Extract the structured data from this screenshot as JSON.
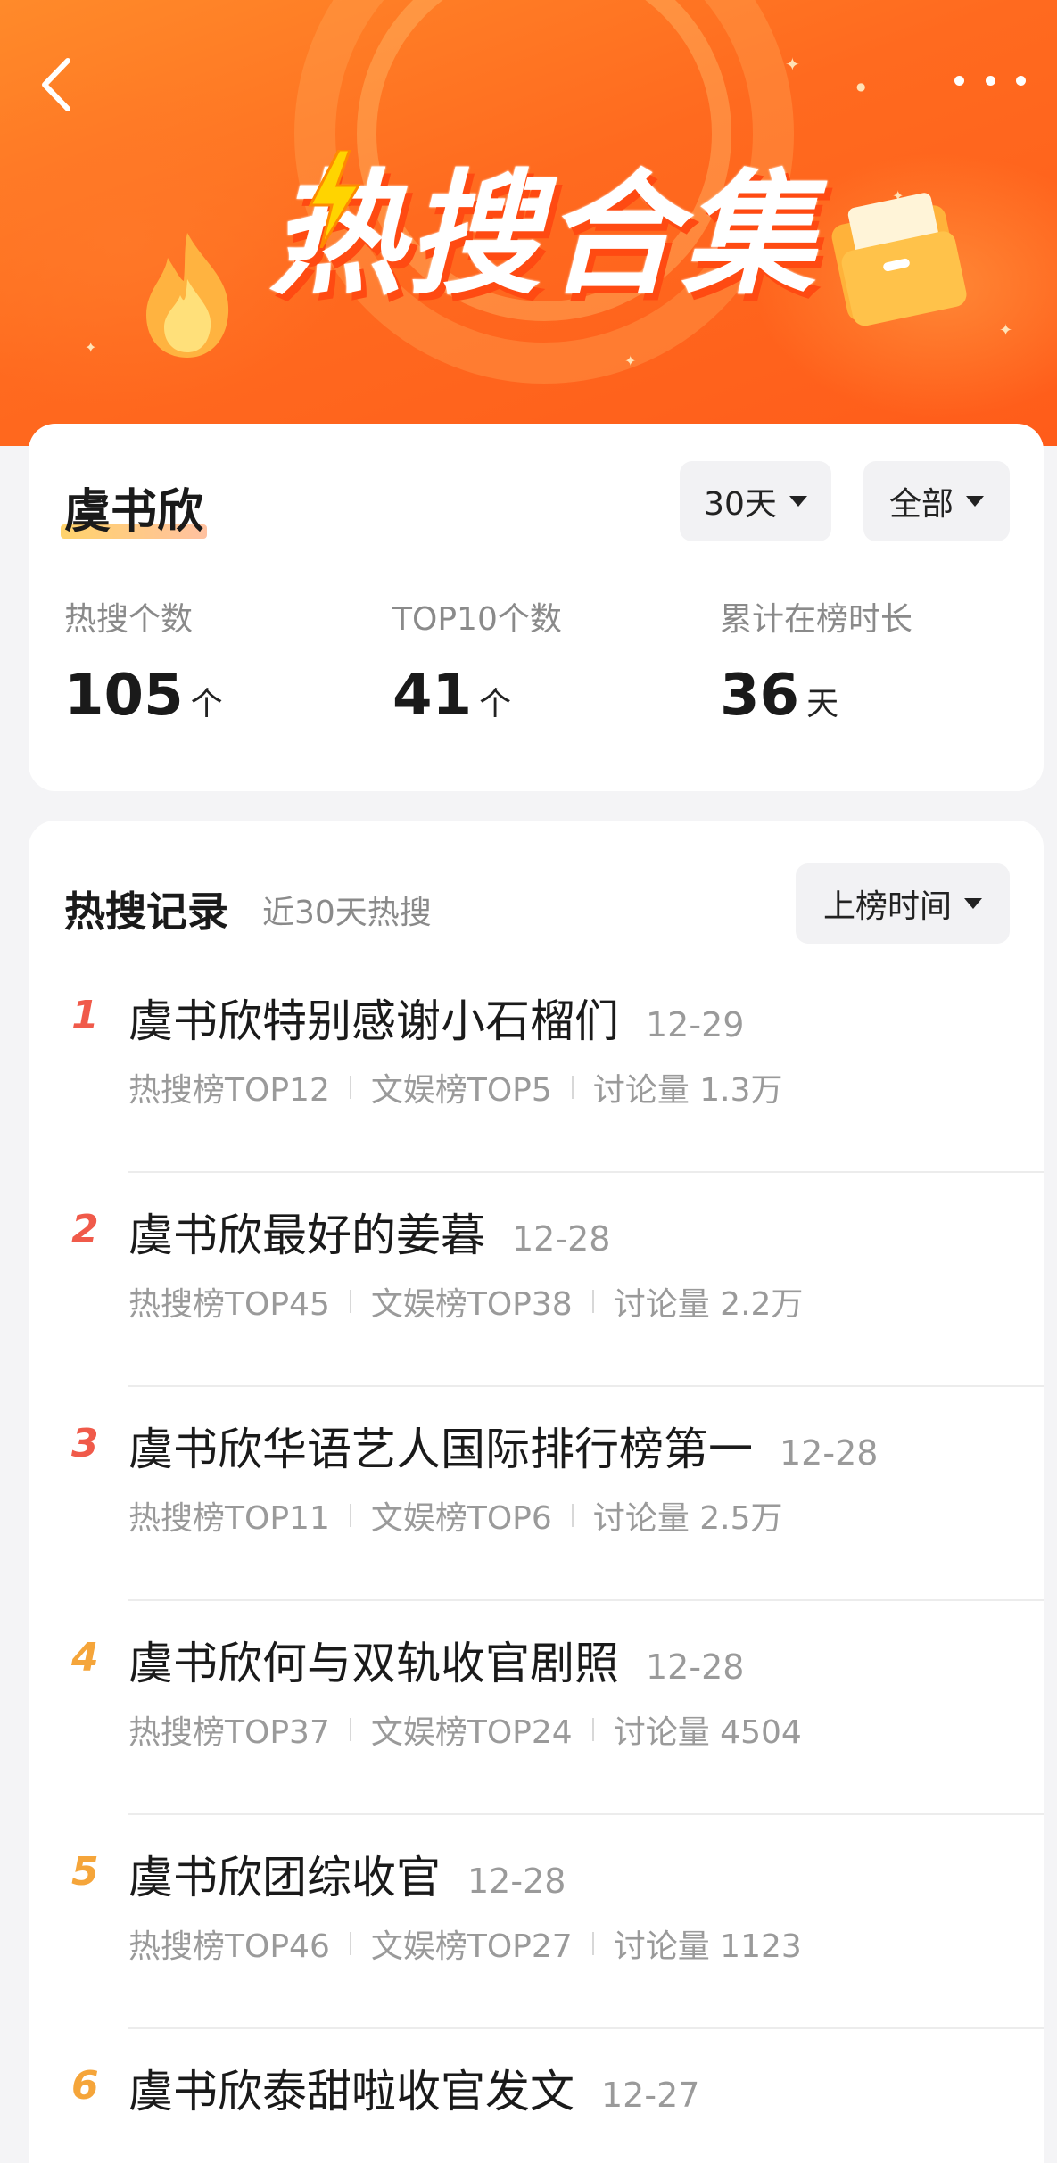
{
  "header": {
    "title_art": "热搜合集",
    "back_icon": "chevron-left-icon",
    "more_icon": "more-dots-icon",
    "colors": {
      "banner_start": "#ff8a2a",
      "banner_end": "#ff5c1a"
    }
  },
  "summary": {
    "name": "虞书欣",
    "days_filter": "30天",
    "category_filter": "全部",
    "stats": [
      {
        "label": "热搜个数",
        "value": "105",
        "unit": "个"
      },
      {
        "label": "TOP10个数",
        "value": "41",
        "unit": "个"
      },
      {
        "label": "累计在榜时长",
        "value": "36",
        "unit": "天"
      }
    ]
  },
  "records": {
    "title": "热搜记录",
    "subtitle": "近30天热搜",
    "sort_label": "上榜时间",
    "rank_colors": {
      "top3": "#f05a4a",
      "other": "#f5a53a"
    },
    "items": [
      {
        "rank": "1",
        "topic": "虞书欣特别感谢小石榴们",
        "date": "12-29",
        "hot": "热搜榜TOP12",
        "ent": "文娱榜TOP5",
        "discuss": "讨论量 1.3万"
      },
      {
        "rank": "2",
        "topic": "虞书欣最好的姜暮",
        "date": "12-28",
        "hot": "热搜榜TOP45",
        "ent": "文娱榜TOP38",
        "discuss": "讨论量 2.2万"
      },
      {
        "rank": "3",
        "topic": "虞书欣华语艺人国际排行榜第一",
        "date": "12-28",
        "hot": "热搜榜TOP11",
        "ent": "文娱榜TOP6",
        "discuss": "讨论量 2.5万"
      },
      {
        "rank": "4",
        "topic": "虞书欣何与双轨收官剧照",
        "date": "12-28",
        "hot": "热搜榜TOP37",
        "ent": "文娱榜TOP24",
        "discuss": "讨论量 4504"
      },
      {
        "rank": "5",
        "topic": "虞书欣团综收官",
        "date": "12-28",
        "hot": "热搜榜TOP46",
        "ent": "文娱榜TOP27",
        "discuss": "讨论量 1123"
      },
      {
        "rank": "6",
        "topic": "虞书欣泰甜啦收官发文",
        "date": "12-27",
        "hot": "",
        "ent": "",
        "discuss": ""
      }
    ]
  }
}
